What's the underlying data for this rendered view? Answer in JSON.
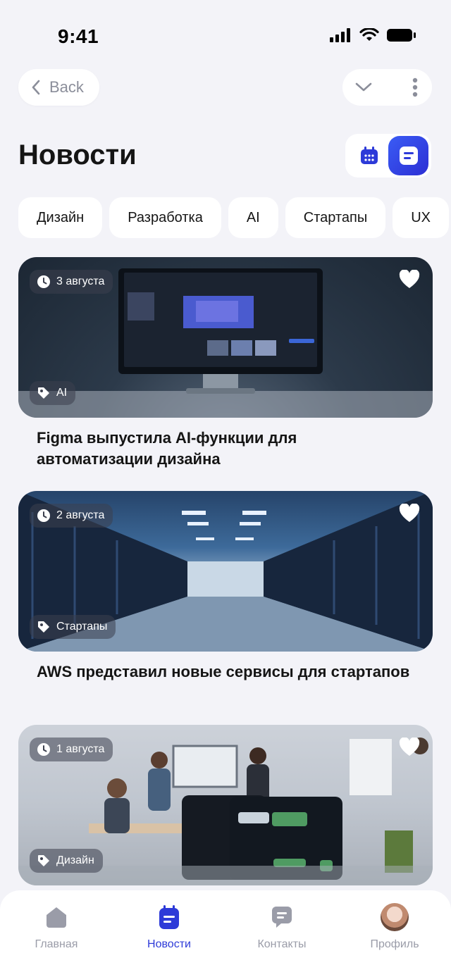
{
  "status": {
    "time": "9:41"
  },
  "header": {
    "back_label": "Back",
    "title": "Новости"
  },
  "categories": [
    "Дизайн",
    "Разработка",
    "AI",
    "Стартапы",
    "UX"
  ],
  "news": [
    {
      "date": "3 августа",
      "tag": "AI",
      "title": "Figma выпустила AI-функции для автоматизации дизайна"
    },
    {
      "date": "2 августа",
      "tag": "Стартапы",
      "title": "AWS представил новые сервисы для стартапов"
    },
    {
      "date": "1 августа",
      "tag": "Дизайн",
      "title": ""
    }
  ],
  "nav": {
    "items": [
      {
        "label": "Главная",
        "icon": "home-icon"
      },
      {
        "label": "Новости",
        "icon": "news-icon"
      },
      {
        "label": "Контакты",
        "icon": "chat-icon"
      },
      {
        "label": "Профиль",
        "icon": "avatar"
      }
    ],
    "active": "Новости"
  },
  "colors": {
    "accent": "#2d3ad8",
    "background": "#f3f3f8",
    "muted": "#9a9ca8"
  }
}
